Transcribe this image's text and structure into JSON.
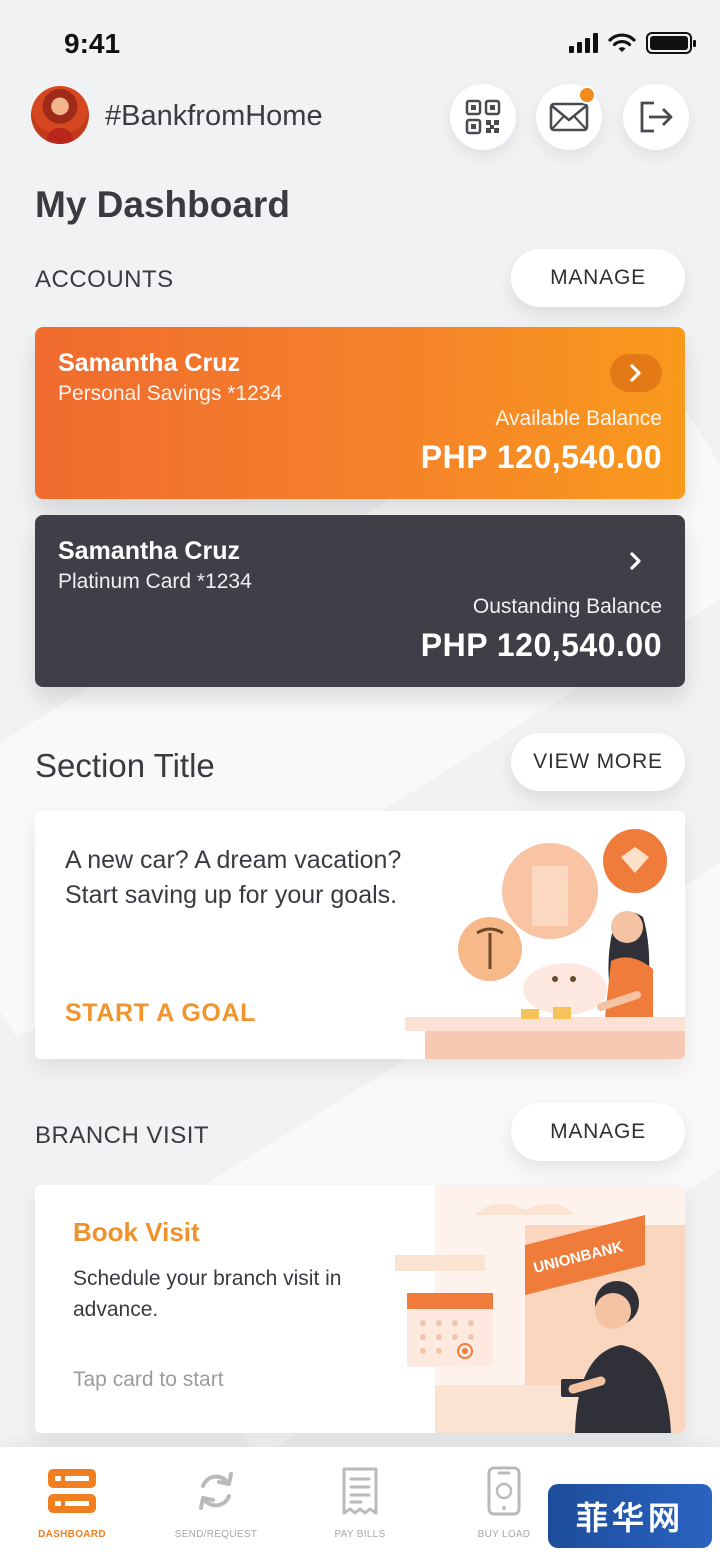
{
  "status_bar": {
    "time": "9:41"
  },
  "header": {
    "title": "#BankfromHome"
  },
  "page_title": "My Dashboard",
  "accounts": {
    "label": "ACCOUNTS",
    "manage_label": "MANAGE",
    "cards": [
      {
        "name": "Samantha Cruz",
        "subtitle": "Personal Savings *1234",
        "balance_label": "Available Balance",
        "balance": "PHP 120,540.00",
        "color": "#f5822a"
      },
      {
        "name": "Samantha Cruz",
        "subtitle": "Platinum Card *1234",
        "balance_label": "Oustanding Balance",
        "balance": "PHP 120,540.00",
        "color": "#3f4047"
      }
    ]
  },
  "section": {
    "title": "Section Title",
    "view_more_label": "VIEW MORE",
    "promo_text": "A new car? A dream vacation? Start saving up for your goals.",
    "promo_link": "START A GOAL"
  },
  "branch_visit": {
    "label": "BRANCH VISIT",
    "manage_label": "MANAGE",
    "card_title": "Book Visit",
    "card_desc": "Schedule your branch visit in advance.",
    "card_hint": "Tap card to start",
    "sign_text": "UNIONBANK"
  },
  "tabs": [
    {
      "label": "DASHBOARD",
      "icon": "dashboard-icon",
      "active": true
    },
    {
      "label": "SEND/REQUEST",
      "icon": "refresh-arrows-icon",
      "active": false
    },
    {
      "label": "PAY BILLS",
      "icon": "receipt-icon",
      "active": false
    },
    {
      "label": "BUY LOAD",
      "icon": "phone-icon",
      "active": false
    }
  ],
  "watermark": "菲华网",
  "colors": {
    "accent": "#f07f22",
    "dark_card": "#3f4047",
    "background": "#f1f2f4"
  }
}
